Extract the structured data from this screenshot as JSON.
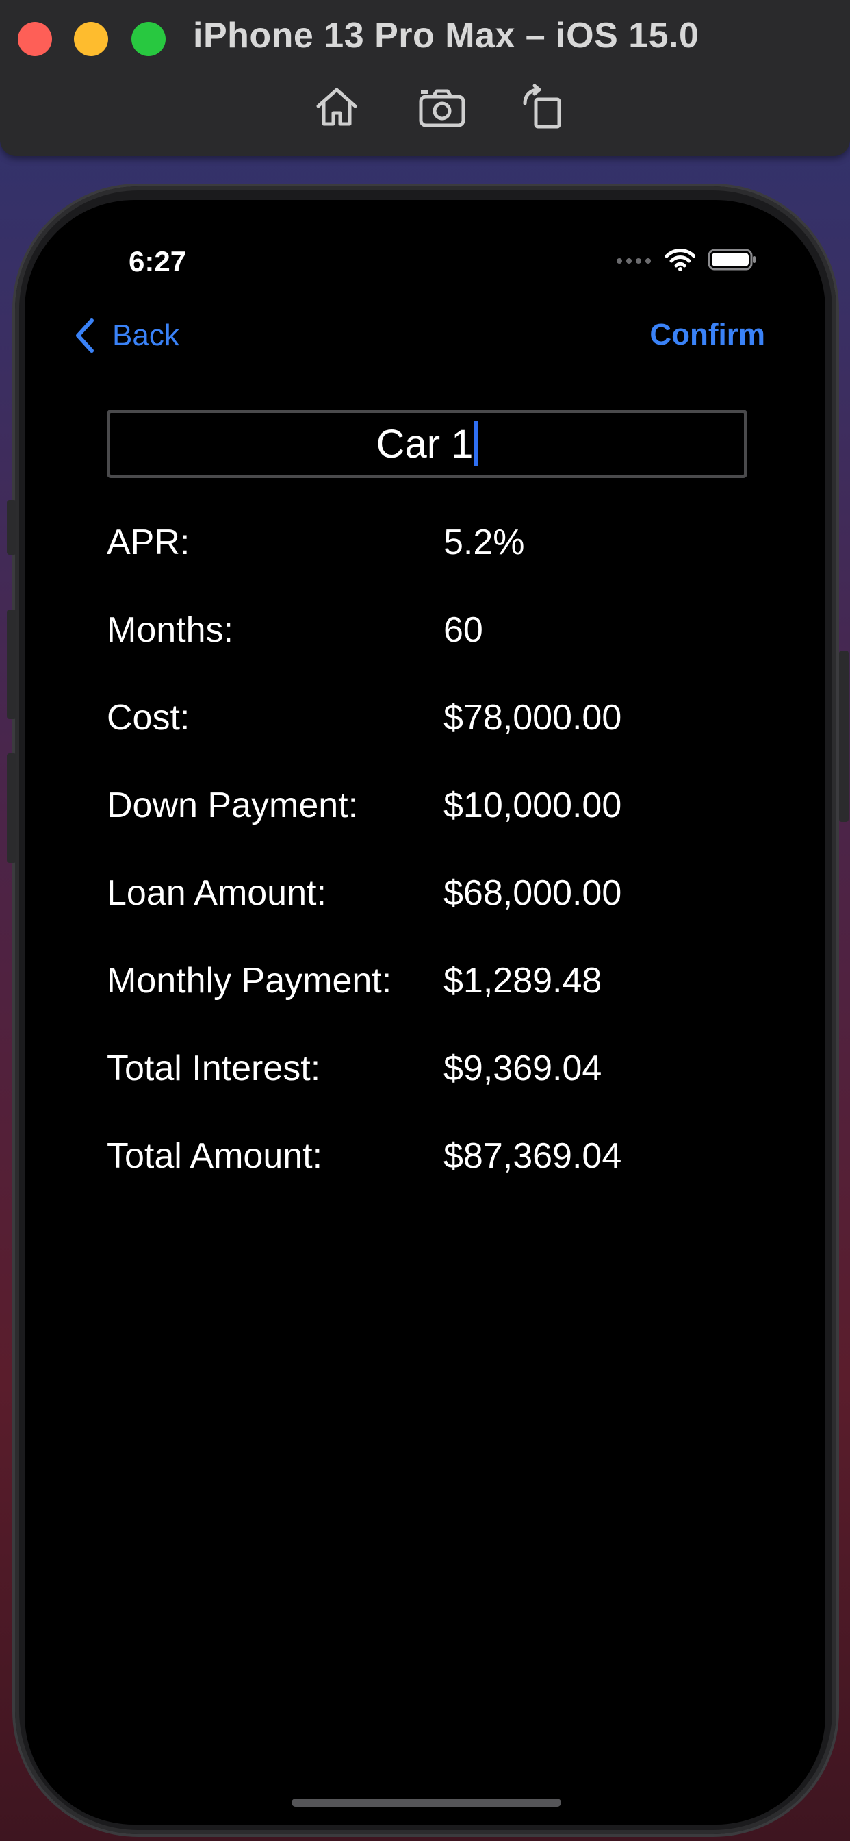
{
  "simulator": {
    "title": "iPhone 13 Pro Max – iOS 15.0",
    "buttons": [
      "home-icon",
      "screenshot-icon",
      "rotate-icon"
    ]
  },
  "status_bar": {
    "time": "6:27",
    "icons": [
      "signal-icon",
      "wifi-icon",
      "battery-icon"
    ]
  },
  "nav": {
    "back_label": "Back",
    "confirm_label": "Confirm",
    "accent_color": "#3a82f7"
  },
  "name_field": {
    "value": "Car 1"
  },
  "details": [
    {
      "label": "APR:",
      "value": "5.2%"
    },
    {
      "label": "Months:",
      "value": "60"
    },
    {
      "label": "Cost:",
      "value": "$78,000.00"
    },
    {
      "label": "Down Payment:",
      "value": "$10,000.00"
    },
    {
      "label": "Loan Amount:",
      "value": "$68,000.00"
    },
    {
      "label": "Monthly Payment:",
      "value": "$1,289.48"
    },
    {
      "label": "Total Interest:",
      "value": "$9,369.04"
    },
    {
      "label": "Total Amount:",
      "value": "$87,369.04"
    }
  ]
}
